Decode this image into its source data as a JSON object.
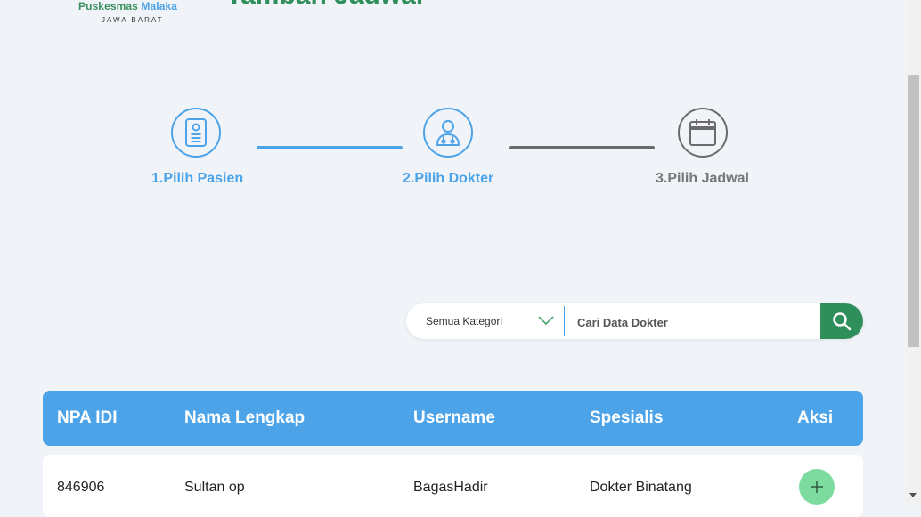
{
  "header": {
    "logo_name_green": "Puskesmas",
    "logo_name_blue": "Malaka",
    "logo_sub": "JAWA BARAT",
    "page_title": "Tambah Jadwal"
  },
  "stepper": {
    "steps": [
      {
        "label": "1.Pilih Pasien",
        "icon": "patient-card-icon",
        "state": "done"
      },
      {
        "label": "2.Pilih Dokter",
        "icon": "doctor-icon",
        "state": "active"
      },
      {
        "label": "3.Pilih Jadwal",
        "icon": "calendar-icon",
        "state": "inactive"
      }
    ]
  },
  "search": {
    "category_selected": "Semua Kategori",
    "placeholder": "Cari Data Dokter",
    "value": ""
  },
  "table": {
    "columns": [
      "NPA IDI",
      "Nama Lengkap",
      "Username",
      "Spesialis",
      "Aksi"
    ],
    "rows": [
      {
        "npa": "846906",
        "nama": "Sultan op",
        "username": "BagasHadir",
        "spesialis": "Dokter Binatang",
        "aksi": "+"
      }
    ]
  },
  "colors": {
    "primary_blue": "#4da3e8",
    "brand_green": "#2e8f5a",
    "action_green": "#7ddba0",
    "inactive_gray": "#6b6b6b"
  }
}
